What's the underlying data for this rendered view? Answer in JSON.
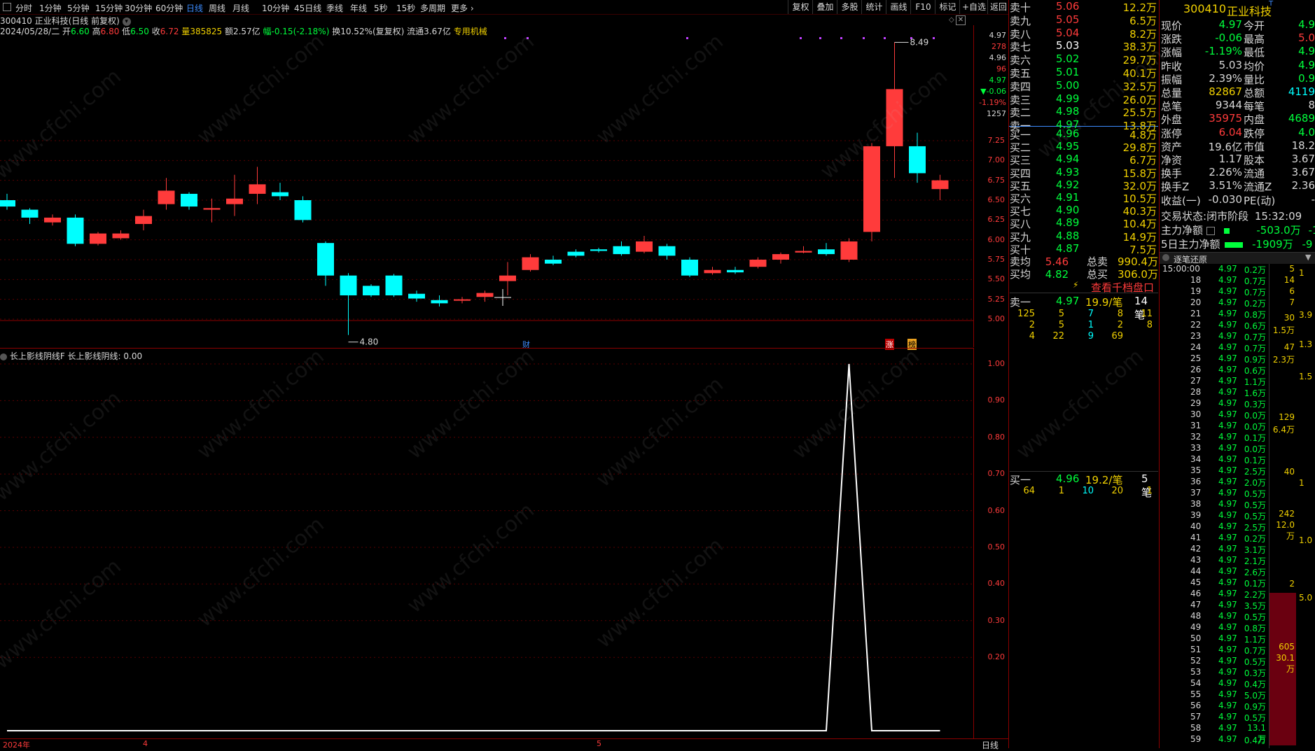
{
  "toolbar": {
    "periods": [
      "分时",
      "1分钟",
      "5分钟",
      "15分钟",
      "30分钟",
      "60分钟",
      "日线",
      "周线",
      "月线",
      "10分钟",
      "45日线",
      "季线",
      "年线",
      "5秒",
      "15秒",
      "多周期",
      "更多"
    ],
    "active_period": "日线",
    "tools": [
      "复权",
      "叠加",
      "多股",
      "统计",
      "画线",
      "F10",
      "标记",
      "+自选",
      "返回"
    ]
  },
  "stock": {
    "title": "300410 正业科技(日线 前复权)",
    "date": "2024/05/28/二",
    "open_label": "开",
    "open": "6.60",
    "high_label": "高",
    "high": "6.80",
    "low_label": "低",
    "low": "6.50",
    "close_label": "收",
    "close": "6.72",
    "vol_label": "量",
    "vol": "385825",
    "amt": "额2.57亿",
    "change": "幅-0.15(-2.18%)",
    "turnover": "换10.52%(复复权)",
    "float": "流通3.67亿",
    "special": "专用机械"
  },
  "price_axis": {
    "top_values": [
      "4.97",
      "278",
      "4.96",
      "96",
      "4.97",
      "▼-0.06",
      "-1.19%",
      "1257"
    ],
    "ticks": [
      "7.25",
      "7.00",
      "6.75",
      "6.50",
      "6.25",
      "6.00",
      "5.75",
      "5.50",
      "5.25",
      "5.00"
    ],
    "high_label": "8.49",
    "low_label": "4.80"
  },
  "chart_data": {
    "type": "candlestick",
    "ylim": [
      4.8,
      8.6
    ],
    "candles": [
      {
        "o": 6.5,
        "c": 6.42,
        "h": 6.58,
        "l": 6.38
      },
      {
        "o": 6.38,
        "c": 6.28,
        "h": 6.4,
        "l": 6.2
      },
      {
        "o": 6.22,
        "c": 6.28,
        "h": 6.32,
        "l": 6.18
      },
      {
        "o": 6.28,
        "c": 5.95,
        "h": 6.32,
        "l": 5.92
      },
      {
        "o": 5.95,
        "c": 6.08,
        "h": 6.1,
        "l": 5.93
      },
      {
        "o": 6.02,
        "c": 6.08,
        "h": 6.12,
        "l": 6.0
      },
      {
        "o": 6.2,
        "c": 6.3,
        "h": 6.38,
        "l": 6.12
      },
      {
        "o": 6.45,
        "c": 6.62,
        "h": 6.78,
        "l": 6.38
      },
      {
        "o": 6.58,
        "c": 6.42,
        "h": 6.6,
        "l": 6.38
      },
      {
        "o": 6.38,
        "c": 6.4,
        "h": 6.52,
        "l": 6.22
      },
      {
        "o": 6.45,
        "c": 6.52,
        "h": 6.82,
        "l": 6.3
      },
      {
        "o": 6.58,
        "c": 6.7,
        "h": 6.92,
        "l": 6.45
      },
      {
        "o": 6.6,
        "c": 6.55,
        "h": 6.72,
        "l": 6.5
      },
      {
        "o": 6.5,
        "c": 6.25,
        "h": 6.55,
        "l": 6.22
      },
      {
        "o": 5.96,
        "c": 5.55,
        "h": 5.98,
        "l": 5.42
      },
      {
        "o": 5.55,
        "c": 5.3,
        "h": 5.58,
        "l": 4.8
      },
      {
        "o": 5.42,
        "c": 5.3,
        "h": 5.44,
        "l": 5.28
      },
      {
        "o": 5.55,
        "c": 5.3,
        "h": 5.57,
        "l": 5.28
      },
      {
        "o": 5.32,
        "c": 5.26,
        "h": 5.36,
        "l": 5.22
      },
      {
        "o": 5.24,
        "c": 5.2,
        "h": 5.3,
        "l": 5.16
      },
      {
        "o": 5.24,
        "c": 5.25,
        "h": 5.28,
        "l": 5.2
      },
      {
        "o": 5.28,
        "c": 5.33,
        "h": 5.36,
        "l": 5.22
      },
      {
        "o": 5.48,
        "c": 5.55,
        "h": 5.72,
        "l": 5.3
      },
      {
        "o": 5.62,
        "c": 5.78,
        "h": 5.82,
        "l": 5.6
      },
      {
        "o": 5.75,
        "c": 5.7,
        "h": 5.8,
        "l": 5.68
      },
      {
        "o": 5.85,
        "c": 5.8,
        "h": 5.88,
        "l": 5.78
      },
      {
        "o": 5.88,
        "c": 5.86,
        "h": 5.9,
        "l": 5.84
      },
      {
        "o": 5.92,
        "c": 5.82,
        "h": 5.98,
        "l": 5.8
      },
      {
        "o": 5.85,
        "c": 5.98,
        "h": 6.05,
        "l": 5.83
      },
      {
        "o": 5.92,
        "c": 5.8,
        "h": 5.95,
        "l": 5.75
      },
      {
        "o": 5.75,
        "c": 5.55,
        "h": 5.78,
        "l": 5.53
      },
      {
        "o": 5.58,
        "c": 5.62,
        "h": 5.66,
        "l": 5.56
      },
      {
        "o": 5.62,
        "c": 5.59,
        "h": 5.66,
        "l": 5.57
      },
      {
        "o": 5.66,
        "c": 5.75,
        "h": 5.78,
        "l": 5.64
      },
      {
        "o": 5.75,
        "c": 5.82,
        "h": 5.84,
        "l": 5.7
      },
      {
        "o": 5.84,
        "c": 5.86,
        "h": 5.92,
        "l": 5.83
      },
      {
        "o": 5.88,
        "c": 5.82,
        "h": 5.96,
        "l": 5.8
      },
      {
        "o": 5.75,
        "c": 5.98,
        "h": 6.02,
        "l": 5.72
      },
      {
        "o": 6.1,
        "c": 7.18,
        "h": 7.22,
        "l": 5.98
      },
      {
        "o": 7.18,
        "c": 7.9,
        "h": 8.49,
        "l": 6.78
      },
      {
        "o": 7.18,
        "c": 6.84,
        "h": 7.35,
        "l": 6.72
      },
      {
        "o": 6.64,
        "c": 6.75,
        "h": 6.82,
        "l": 6.5
      }
    ],
    "up_color": "#ff3b3b",
    "down_color": "#00ffff"
  },
  "indicator": {
    "label": "长上影线阴线F 长上影线阴线: 0.00",
    "ticks": [
      "1.00",
      "0.90",
      "0.80",
      "0.70",
      "0.60",
      "0.50",
      "0.40",
      "0.30",
      "0.20"
    ],
    "signal": [
      0,
      0,
      0,
      0,
      0,
      0,
      0,
      0,
      0,
      0,
      0,
      0,
      0,
      0,
      0,
      0,
      0,
      0,
      0,
      0,
      0,
      0,
      0,
      0,
      0,
      0,
      0,
      0,
      0,
      0,
      0,
      0,
      0,
      0,
      0,
      0,
      0,
      1,
      0,
      0,
      0,
      0
    ],
    "line_color": "#ffffff"
  },
  "bottom_axis": {
    "date_labels": [
      "2024年",
      "4",
      "5"
    ],
    "period_label": "日线"
  },
  "markers": {
    "finance": "财",
    "limit": "涨",
    "boost": "榜"
  },
  "order_book": {
    "asks": [
      {
        "label": "卖十",
        "price": "5.06",
        "vol": "12.2万"
      },
      {
        "label": "卖九",
        "price": "5.05",
        "vol": "6.5万"
      },
      {
        "label": "卖八",
        "price": "5.04",
        "vol": "8.2万"
      },
      {
        "label": "卖七",
        "price": "5.03",
        "vol": "38.3万"
      },
      {
        "label": "卖六",
        "price": "5.02",
        "vol": "29.7万"
      },
      {
        "label": "卖五",
        "price": "5.01",
        "vol": "40.1万"
      },
      {
        "label": "卖四",
        "price": "5.00",
        "vol": "32.5万"
      },
      {
        "label": "卖三",
        "price": "4.99",
        "vol": "26.0万"
      },
      {
        "label": "卖二",
        "price": "4.98",
        "vol": "25.5万"
      },
      {
        "label": "卖一",
        "price": "4.97",
        "vol": "13.8万"
      }
    ],
    "bids": [
      {
        "label": "买一",
        "price": "4.96",
        "vol": "4.8万"
      },
      {
        "label": "买二",
        "price": "4.95",
        "vol": "29.8万"
      },
      {
        "label": "买三",
        "price": "4.94",
        "vol": "6.7万"
      },
      {
        "label": "买四",
        "price": "4.93",
        "vol": "15.8万"
      },
      {
        "label": "买五",
        "price": "4.92",
        "vol": "32.0万"
      },
      {
        "label": "买六",
        "price": "4.91",
        "vol": "10.5万"
      },
      {
        "label": "买七",
        "price": "4.90",
        "vol": "40.3万"
      },
      {
        "label": "买八",
        "price": "4.89",
        "vol": "10.4万"
      },
      {
        "label": "买九",
        "price": "4.88",
        "vol": "14.9万"
      },
      {
        "label": "买十",
        "price": "4.87",
        "vol": "7.5万"
      }
    ],
    "ask_avg_label": "卖均",
    "ask_avg": "5.46",
    "total_sell_label": "总卖",
    "total_sell": "990.4万",
    "bid_avg_label": "买均",
    "bid_avg": "4.82",
    "total_buy_label": "总买",
    "total_buy": "306.0万",
    "thousand_btn": "查看千档盘口",
    "ask1_detail": {
      "label": "卖一",
      "price": "4.97",
      "per": "19.9/笔",
      "count": "14笔",
      "rows": [
        [
          "125",
          "5",
          "7",
          "8",
          "11"
        ],
        [
          "2",
          "5",
          "1",
          "2",
          "8"
        ],
        [
          "4",
          "22",
          "9",
          "69",
          ""
        ]
      ]
    },
    "bid1_detail": {
      "label": "买一",
      "price": "4.96",
      "per": "19.2/笔",
      "count": "5笔",
      "rows": [
        [
          "64",
          "1",
          "10",
          "20",
          "1"
        ]
      ]
    }
  },
  "quote": {
    "code": "300410",
    "name": "正业科技",
    "rows": [
      {
        "l1": "现价",
        "v1": "4.97",
        "l2": "今开",
        "v2": "4.9"
      },
      {
        "l1": "涨跌",
        "v1": "-0.06",
        "l2": "最高",
        "v2": "5.0"
      },
      {
        "l1": "涨幅",
        "v1": "-1.19%",
        "l2": "最低",
        "v2": "4.9"
      },
      {
        "l1": "昨收",
        "v1": "5.03",
        "l2": "均价",
        "v2": "4.9"
      },
      {
        "l1": "振幅",
        "v1": "2.39%",
        "l2": "量比",
        "v2": "0.9"
      },
      {
        "l1": "总量",
        "v1": "82867",
        "l2": "总额",
        "v2": "4119"
      },
      {
        "l1": "总笔",
        "v1": "9344",
        "l2": "每笔",
        "v2": "8"
      },
      {
        "l1": "外盘",
        "v1": "35975",
        "l2": "内盘",
        "v2": "4689"
      },
      {
        "l1": "涨停",
        "v1": "6.04",
        "l2": "跌停",
        "v2": "4.0"
      },
      {
        "l1": "资产",
        "v1": "19.6亿",
        "l2": "市值",
        "v2": "18.2"
      },
      {
        "l1": "净资",
        "v1": "1.17",
        "l2": "股本",
        "v2": "3.67"
      },
      {
        "l1": "换手",
        "v1": "2.26%",
        "l2": "流通",
        "v2": "3.67"
      },
      {
        "l1": "换手Z",
        "v1": "3.51%",
        "l2": "流通Z",
        "v2": "2.36"
      },
      {
        "l1": "收益(一)",
        "v1": "-0.030",
        "l2": "PE(动)",
        "v2": "-"
      }
    ],
    "status_label": "交易状态:",
    "status": "闭市阶段",
    "status_time": "15:32:09",
    "main_net_label": "主力净额",
    "main_net": "-503.0万",
    "main_net2": "-12",
    "main5_label": "5日主力净额",
    "main5": "-1909万",
    "main5_2": "-9"
  },
  "ticks_panel": {
    "title": "逐笔还原",
    "first_time": "15:00:00",
    "rows": [
      [
        "15:00:00",
        "4.97",
        "0.2万"
      ],
      [
        "18",
        "4.97",
        "0.7万"
      ],
      [
        "19",
        "4.97",
        "0.7万"
      ],
      [
        "20",
        "4.97",
        "0.2万"
      ],
      [
        "21",
        "4.97",
        "0.8万"
      ],
      [
        "22",
        "4.97",
        "0.6万"
      ],
      [
        "23",
        "4.97",
        "0.7万"
      ],
      [
        "24",
        "4.97",
        "0.7万"
      ],
      [
        "25",
        "4.97",
        "0.9万"
      ],
      [
        "26",
        "4.97",
        "0.6万"
      ],
      [
        "27",
        "4.97",
        "1.1万"
      ],
      [
        "28",
        "4.97",
        "1.6万"
      ],
      [
        "29",
        "4.97",
        "0.3万"
      ],
      [
        "30",
        "4.97",
        "0.0万"
      ],
      [
        "31",
        "4.97",
        "0.0万"
      ],
      [
        "32",
        "4.97",
        "0.1万"
      ],
      [
        "33",
        "4.97",
        "0.0万"
      ],
      [
        "34",
        "4.97",
        "0.1万"
      ],
      [
        "35",
        "4.97",
        "2.5万"
      ],
      [
        "36",
        "4.97",
        "2.0万"
      ],
      [
        "37",
        "4.97",
        "0.5万"
      ],
      [
        "38",
        "4.97",
        "0.5万"
      ],
      [
        "39",
        "4.97",
        "0.5万"
      ],
      [
        "40",
        "4.97",
        "2.5万"
      ],
      [
        "41",
        "4.97",
        "0.2万"
      ],
      [
        "42",
        "4.97",
        "3.1万"
      ],
      [
        "43",
        "4.97",
        "2.1万"
      ],
      [
        "44",
        "4.97",
        "2.6万"
      ],
      [
        "45",
        "4.97",
        "0.1万"
      ],
      [
        "46",
        "4.97",
        "2.2万"
      ],
      [
        "47",
        "4.97",
        "3.5万"
      ],
      [
        "48",
        "4.97",
        "0.5万"
      ],
      [
        "49",
        "4.97",
        "0.8万"
      ],
      [
        "50",
        "4.97",
        "1.1万"
      ],
      [
        "51",
        "4.97",
        "0.7万"
      ],
      [
        "52",
        "4.97",
        "0.5万"
      ],
      [
        "53",
        "4.97",
        "0.3万"
      ],
      [
        "54",
        "4.97",
        "0.4万"
      ],
      [
        "55",
        "4.97",
        "5.0万"
      ],
      [
        "56",
        "4.97",
        "0.9万"
      ],
      [
        "57",
        "4.97",
        "0.5万"
      ],
      [
        "58",
        "4.97",
        "13.1万"
      ],
      [
        "59",
        "4.97",
        "0.4万"
      ]
    ],
    "side_a": [
      "5",
      "14",
      "6",
      "7",
      "30",
      "1.5万",
      "47",
      "2.3万",
      "129",
      "6.4万",
      "40",
      "242",
      "12.0万",
      "2",
      "605",
      "30.1万"
    ],
    "side_b": [
      "1",
      "3.9",
      "1.3",
      "1.5",
      "1",
      "1.0",
      "5.0"
    ]
  },
  "watermark": "www.cfchi.com",
  "colors": {
    "up": "#ff3b3b",
    "down": "#00ff3c",
    "neutral": "#ffffff",
    "yellow": "#f0d000",
    "red_line": "#8b0000",
    "cyan": "#00ffff"
  }
}
